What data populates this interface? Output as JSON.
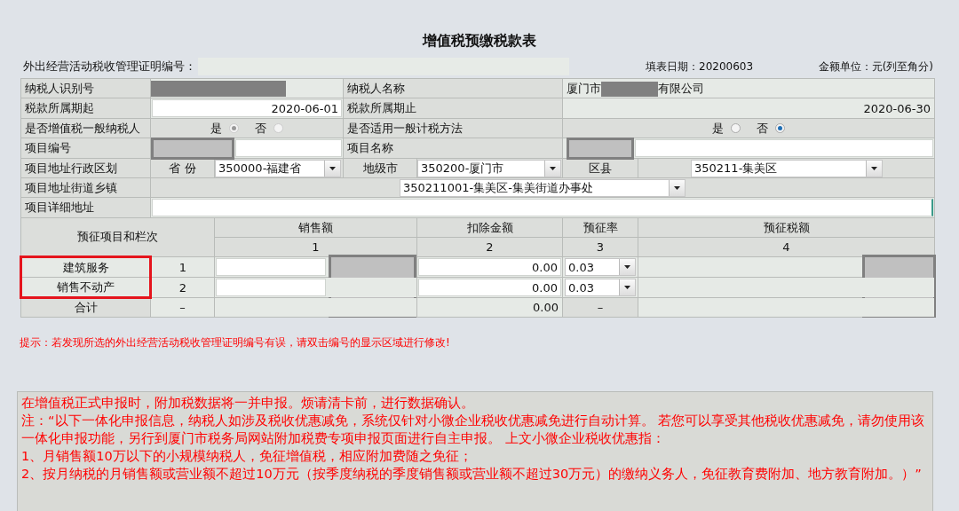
{
  "title": "增值税预缴税款表",
  "header": {
    "cert_label": "外出经营活动税收管理证明编号：",
    "fill_date": "填表日期：20200603",
    "unit": "金额单位：元(列至角分)"
  },
  "taxpayer": {
    "id_label": "纳税人识别号",
    "name_label": "纳税人名称",
    "name_prefix": "厦门市",
    "name_suffix": "有限公司"
  },
  "period": {
    "start_label": "税款所属期起",
    "start": "2020-06-01",
    "end_label": "税款所属期止",
    "end": "2020-06-30"
  },
  "general_taxpayer": {
    "label": "是否增值税一般纳税人",
    "disabled": true,
    "options": [
      {
        "label": "是",
        "selected": true
      },
      {
        "label": "否",
        "selected": false
      }
    ]
  },
  "general_method": {
    "label": "是否适用一般计税方法",
    "disabled": false,
    "options": [
      {
        "label": "是",
        "selected": false
      },
      {
        "label": "否",
        "selected": true
      }
    ]
  },
  "project": {
    "code_label": "项目编号",
    "name_label": "项目名称"
  },
  "region": {
    "label": "项目地址行政区划",
    "province_label": "省 份",
    "province": "350000-福建省",
    "city_label": "地级市",
    "city": "350200-厦门市",
    "county_label": "区县",
    "county": "350211-集美区"
  },
  "street": {
    "label": "项目地址街道乡镇",
    "value": "350211001-集美区-集美街道办事处"
  },
  "detail_address": {
    "label": "项目详细地址"
  },
  "table": {
    "columns": [
      {
        "title": "预征项目和栏次"
      },
      {
        "title": "销售额",
        "number": "1"
      },
      {
        "title": "扣除金额",
        "number": "2"
      },
      {
        "title": "预征率",
        "number": "3"
      },
      {
        "title": "预征税额",
        "number": "4"
      }
    ],
    "rows": [
      {
        "kind": "entry",
        "item": "建筑服务",
        "line": "1",
        "deduction": "0.00",
        "rate": "0.03",
        "highlighted": true
      },
      {
        "kind": "entry",
        "item": "销售不动产",
        "line": "2",
        "deduction": "0.00",
        "rate": "0.03",
        "highlighted": true
      },
      {
        "kind": "total",
        "item": "合计",
        "line": "–",
        "deduction": "0.00",
        "rate": "–",
        "highlighted": false
      }
    ]
  },
  "hint": "提示：若发现所选的外出经营活动税收管理证明编号有误，请双击编号的显示区域进行修改!",
  "notice": [
    "在增值税正式申报时，附加税数据将一并申报。烦请清卡前，进行数据确认。",
    "注：“以下一体化申报信息，纳税人如涉及税收优惠减免，系统仅针对小微企业税收优惠减免进行自动计算。 若您可以享受其他税收优惠减免，请勿使用该一体化申报功能，另行到厦门市税务局网站附加税费专项申报页面进行自主申报。 上文小微企业税收优惠指：",
    "1、月销售额10万以下的小规模纳税人，免征增值税，相应附加费随之免征；",
    "2、按月纳税的月销售额或营业额不超过10万元（按季度纳税的季度销售额或营业额不超过30万元）的缴纳义务人，免征教育费附加、地方教育附加。）”"
  ]
}
